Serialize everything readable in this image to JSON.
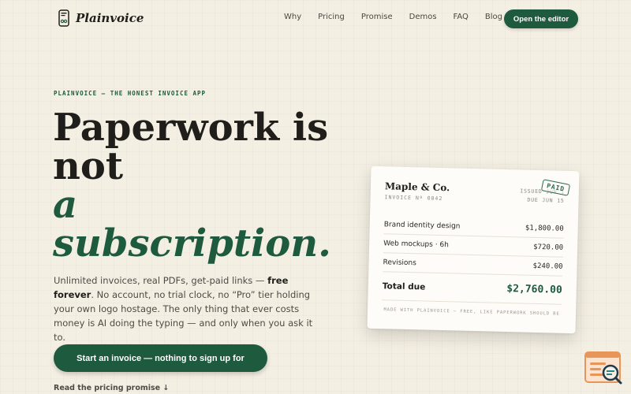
{
  "brand": {
    "name": "Plainvoice",
    "icon": "phone-invoice-icon"
  },
  "nav": {
    "links": [
      "Why",
      "Pricing",
      "Promise",
      "Demos",
      "FAQ",
      "Blog"
    ],
    "cta_label": "Open the editor"
  },
  "hero": {
    "eyebrow": "PLAINVOICE — THE HONEST INVOICE APP",
    "headline_line1": "Paperwork is",
    "headline_line2": "not",
    "headline_line3": "a",
    "headline_line4": "subscription.",
    "lede_part1": "Unlimited invoices, real PDFs, get-paid links — ",
    "lede_bold": "free forever",
    "lede_part2": ". No account, no trial clock, no “Pro” tier holding your own logo hostage. The only thing that ever costs money is AI doing the typing — and only when you ask it to.",
    "cta_label": "Start an invoice — nothing to sign up for",
    "promise_link": "Read the pricing promise ↓"
  },
  "invoice": {
    "company": "Maple & Co.",
    "number": "INVOICE Nº 0042",
    "issued": "ISSUED JUN 1",
    "due": "DUE JUN 15",
    "stamp": "PAID",
    "items": [
      {
        "label": "Brand identity design",
        "amount": "$1,800.00"
      },
      {
        "label": "Web mockups · 6h",
        "amount": "$720.00"
      },
      {
        "label": "Revisions",
        "amount": "$240.00"
      }
    ],
    "total_label": "Total due",
    "total_amount": "$2,760.00",
    "footer": "MADE WITH PLAINVOICE — FREE, LIKE PAPERWORK SHOULD BE"
  },
  "colors": {
    "background": "#f4efe3",
    "accent": "#1e5a3e",
    "text": "#1f1e1a",
    "widget": "#e8955a"
  },
  "widget": {
    "icon": "search-list-icon"
  }
}
